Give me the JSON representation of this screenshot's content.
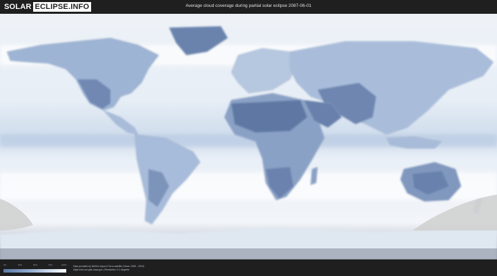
{
  "header": {
    "logo_left": "SOLAR",
    "logo_right": "ECLIPSE.INFO",
    "title": "Average cloud coverage during partial solar eclipse 2087-06-01"
  },
  "legend": {
    "ticks": [
      "0%",
      "25%",
      "50%",
      "75%",
      "100%"
    ],
    "colors": [
      "#5c7aa6",
      "#8fa9cc",
      "#d0dcec",
      "#ffffff"
    ]
  },
  "footer": {
    "credit_line1": "Data provided by NASA's Aqua & Terra satellite (Years: 2000 - 2019)",
    "credit_line2": "https://neo.sci.gsfc.nasa.gov | Resolution: 0.1 degrees"
  },
  "colors": {
    "ocean": "#e6edf5",
    "land_clear": "#6f87b0",
    "eclipse_shadow": "#cfcfcf",
    "background": "#1f1f1f"
  }
}
